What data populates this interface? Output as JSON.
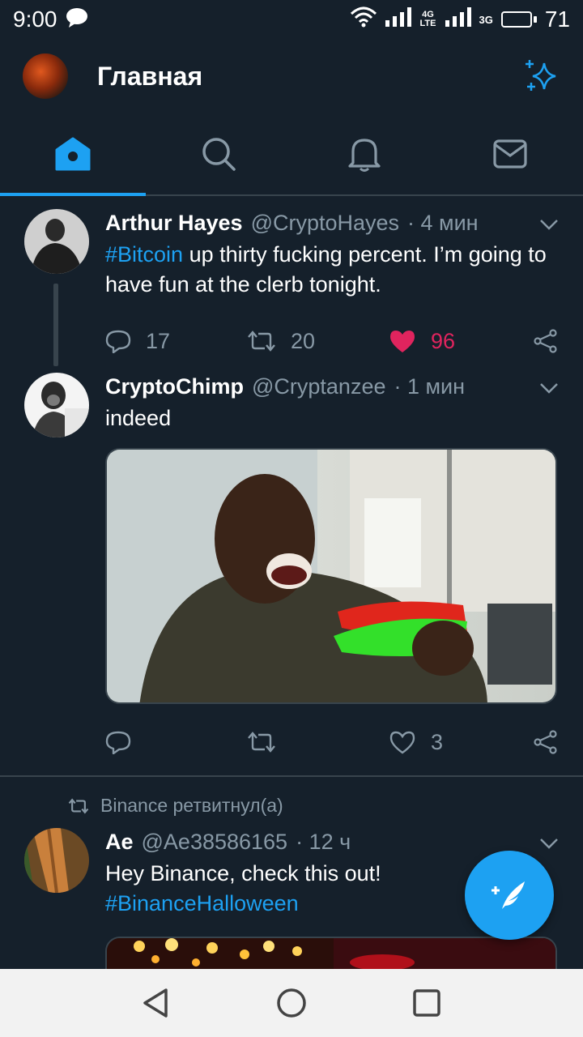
{
  "status_bar": {
    "time": "9:00",
    "network_1": "4G LTE",
    "network_2": "3G",
    "battery": "71",
    "battery_level": 0.71
  },
  "header": {
    "title": "Главная",
    "sparkle_icon": "sparkle-icon"
  },
  "tabs": [
    {
      "name": "home",
      "icon": "home-icon",
      "active": true
    },
    {
      "name": "search",
      "icon": "search-icon",
      "active": false
    },
    {
      "name": "notifications",
      "icon": "bell-icon",
      "active": false
    },
    {
      "name": "messages",
      "icon": "mail-icon",
      "active": false
    }
  ],
  "tweets": [
    {
      "name": "Arthur Hayes",
      "handle": "@CryptoHayes",
      "time": "· 4 мин",
      "hashtag": "#Bitcoin",
      "text": " up thirty fucking percent. I’m going to have fun at the clerb tonight.",
      "replies": "17",
      "retweets": "20",
      "likes": "96",
      "liked": true
    },
    {
      "name": "CryptoChimp",
      "handle": "@Cryptanzee",
      "time": "· 1 мин",
      "text": "indeed",
      "replies": "",
      "retweets": "",
      "likes": "3",
      "liked": false
    },
    {
      "retweeted_by": "Binance ретвитнул(а)",
      "name": "Ae",
      "handle": "@Ae38586165",
      "time": "· 12 ч",
      "text": "Hey Binance, check this out!",
      "hashtag": "#BinanceHalloween"
    }
  ],
  "colors": {
    "background": "#15202b",
    "accent": "#1da1f2",
    "like": "#e0245e",
    "muted": "#8899a6",
    "border": "#38444d"
  }
}
